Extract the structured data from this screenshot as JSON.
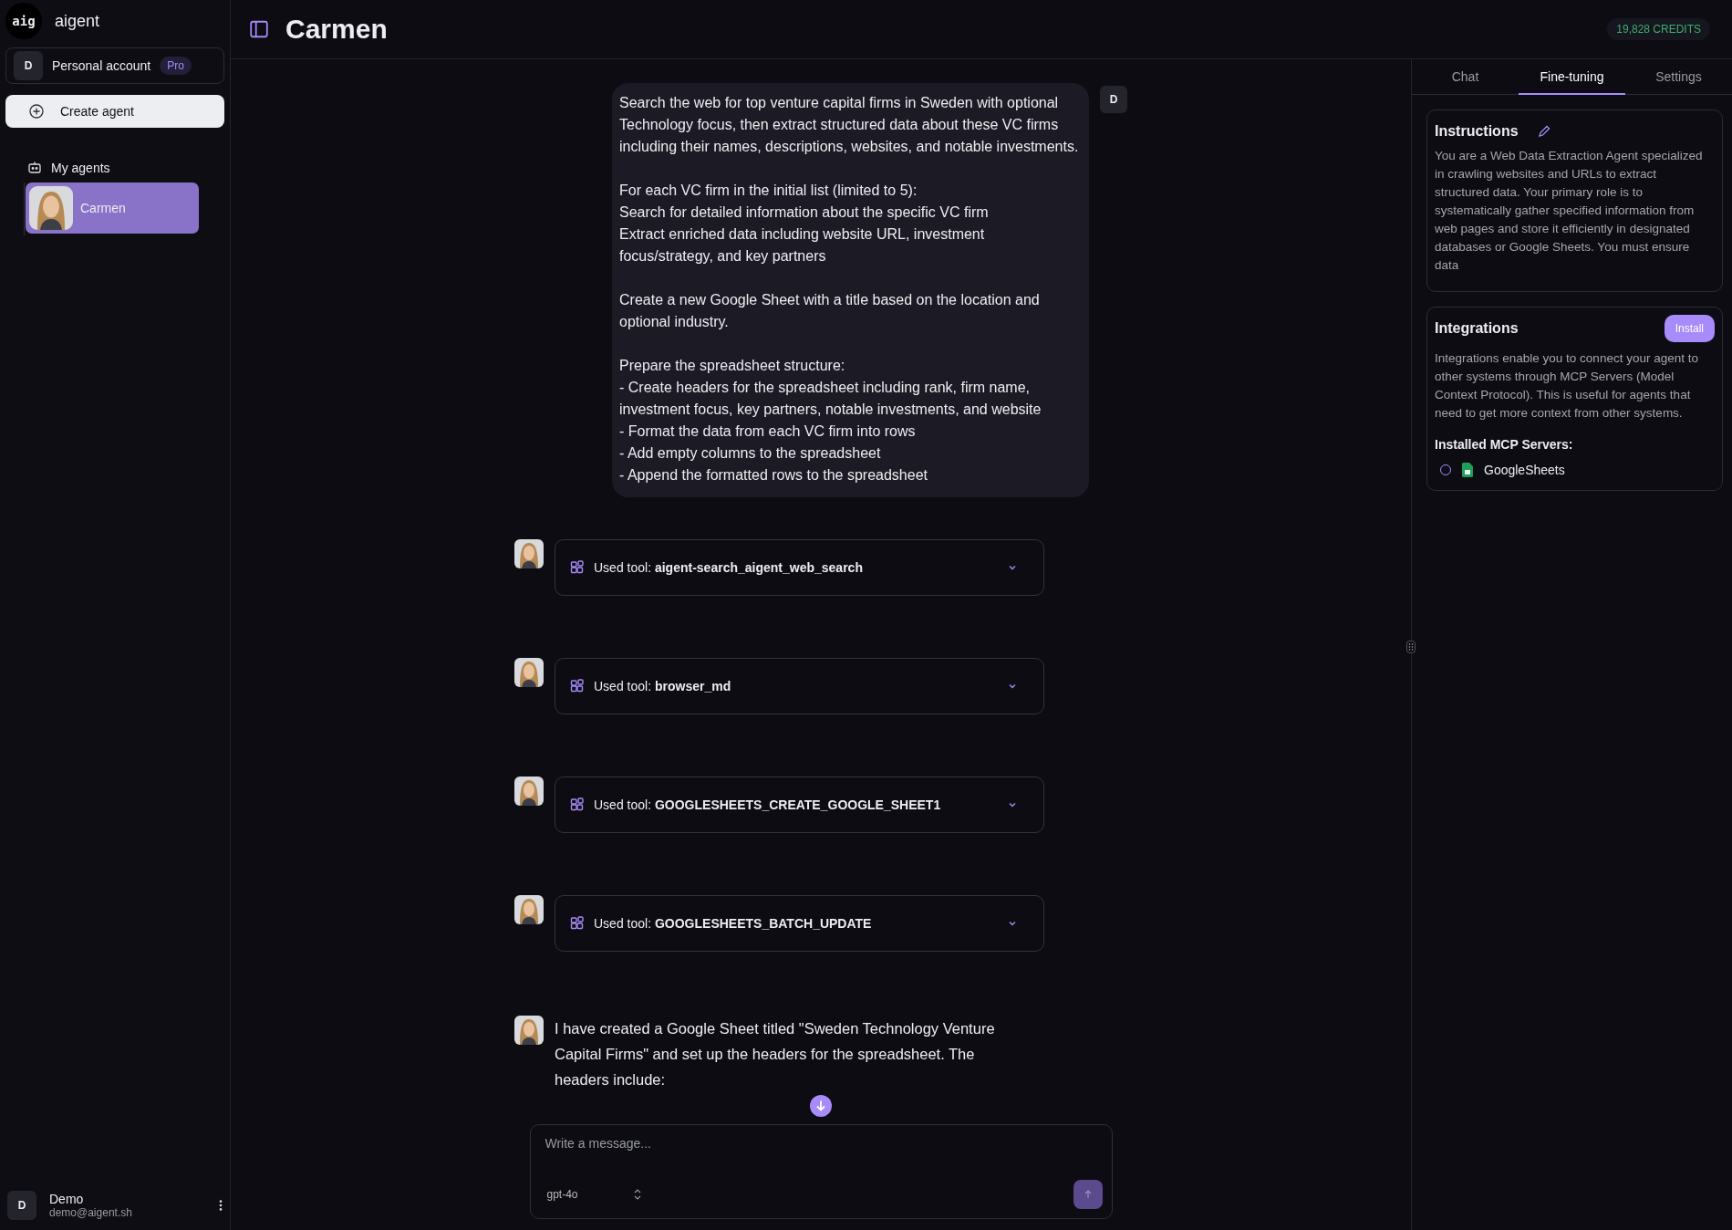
{
  "brand": {
    "logo": "aig",
    "name": "aigent"
  },
  "account": {
    "initial": "D",
    "label": "Personal account",
    "badge": "Pro"
  },
  "create_button": "Create agent",
  "agents_section": {
    "title": "My agents",
    "items": [
      {
        "name": "Carmen",
        "selected": true
      }
    ]
  },
  "user": {
    "initial": "D",
    "name": "Demo",
    "email": "demo@aigent.sh"
  },
  "header": {
    "title": "Carmen",
    "credits": "19,828 CREDITS"
  },
  "messages": [
    {
      "kind": "user",
      "initial": "D",
      "paragraphs": [
        [
          "Search the web for top venture capital firms in Sweden with optional Technology focus, then extract structured data about these VC firms including their names, descriptions, websites, and notable investments."
        ],
        [
          "For each VC firm in the initial list (limited to 5):",
          "Search for detailed information about the specific VC firm",
          "Extract enriched data including website URL, investment focus/strategy, and key partners"
        ],
        [
          "Create a new Google Sheet with a title based on the location and optional industry."
        ],
        [
          "Prepare the spreadsheet structure:",
          "- Create headers for the spreadsheet including rank, firm name, investment focus, key partners, notable investments, and website",
          "- Format the data from each VC firm into rows",
          "- Add empty columns to the spreadsheet",
          "- Append the formatted rows to the spreadsheet"
        ]
      ]
    },
    {
      "kind": "tool",
      "label": "Used tool:",
      "tool": "aigent-search_aigent_web_search",
      "expanded": false
    },
    {
      "kind": "tool",
      "label": "Used tool:",
      "tool": "browser_md",
      "expanded": false
    },
    {
      "kind": "tool",
      "label": "Used tool:",
      "tool": "GOOGLESHEETS_CREATE_GOOGLE_SHEET1",
      "expanded": false
    },
    {
      "kind": "tool",
      "label": "Used tool:",
      "tool": "GOOGLESHEETS_BATCH_UPDATE",
      "expanded": false
    },
    {
      "kind": "assistant",
      "text": "I have created a Google Sheet titled \"Sweden Technology Venture Capital Firms\" and set up the headers for the spreadsheet. The headers include:"
    }
  ],
  "composer": {
    "placeholder": "Write a message...",
    "model": "gpt-4o"
  },
  "panel": {
    "tabs": [
      {
        "label": "Chat",
        "selected": false
      },
      {
        "label": "Fine-tuning",
        "selected": true
      },
      {
        "label": "Settings",
        "selected": false
      }
    ],
    "instructions": {
      "title": "Instructions",
      "text": "You are a Web Data Extraction Agent specialized in crawling websites and URLs to extract structured data. Your primary role is to systematically gather specified information from web pages and store it efficiently in designated databases or Google Sheets. You must ensure data"
    },
    "integrations": {
      "title": "Integrations",
      "button": "Install",
      "text": "Integrations enable you to connect your agent to other systems through MCP Servers (Model Context Protocol). This is useful for agents that need to get more context from other systems.",
      "installed_title": "Installed MCP Servers:",
      "servers": [
        {
          "name": "GoogleSheets",
          "selected": false
        }
      ]
    }
  }
}
